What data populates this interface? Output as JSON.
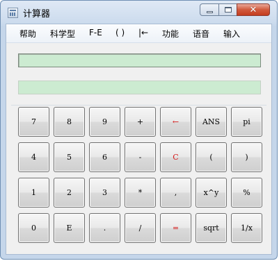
{
  "window": {
    "title": "计算器",
    "close_glyph": "✕"
  },
  "menu": [
    "帮助",
    "科学型",
    "F-E",
    "( )",
    "|←",
    "功能",
    "语音",
    "输入"
  ],
  "display": {
    "expression": "",
    "result": ""
  },
  "keys": [
    [
      "7",
      "8",
      "9",
      "+",
      "←",
      "ANS",
      "pi"
    ],
    [
      "4",
      "5",
      "6",
      "-",
      "C",
      "(",
      ")"
    ],
    [
      "1",
      "2",
      "3",
      "*",
      ",",
      "x^y",
      "%"
    ],
    [
      "0",
      "E",
      ".",
      "/",
      "=",
      "sqrt",
      "1/x"
    ]
  ],
  "colors": {
    "red_key_text": "#d61a1a",
    "display_bg": "#ccebd1"
  }
}
